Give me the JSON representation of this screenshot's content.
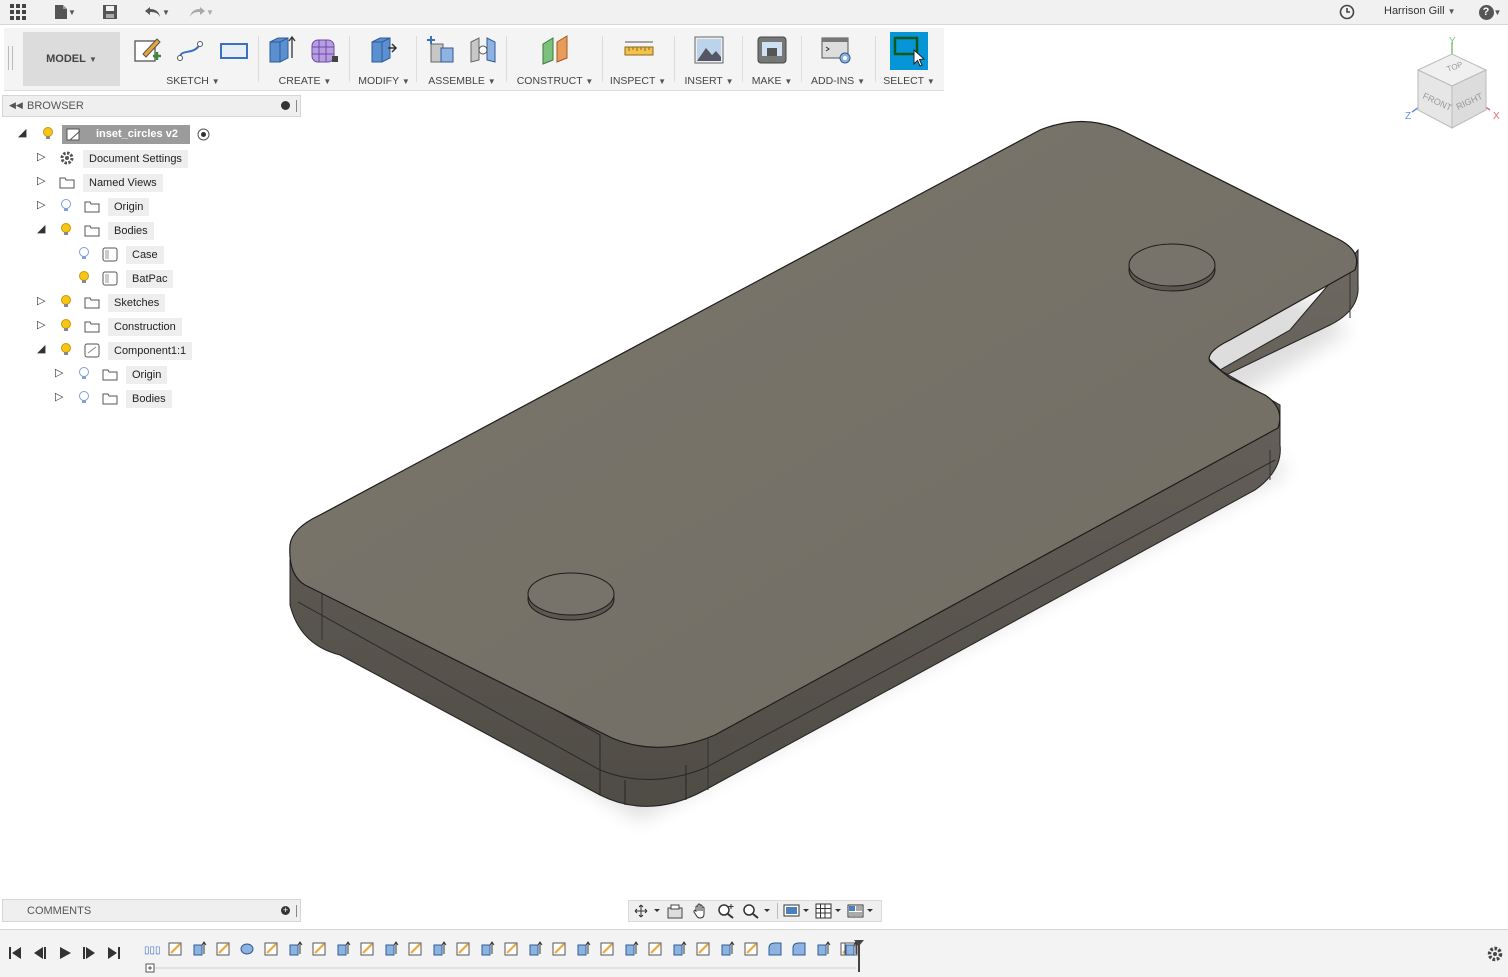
{
  "top_bar": {
    "user_name": "Harrison Gill",
    "icons": [
      "app-grid-icon",
      "file-icon",
      "save-icon",
      "undo-icon",
      "redo-icon",
      "job-status-icon",
      "help-icon"
    ],
    "help_label": "?"
  },
  "toolbar": {
    "workspace": "MODEL",
    "groups": [
      {
        "label": "SKETCH",
        "tools": [
          "create-sketch-icon",
          "line-icon",
          "rectangle-icon"
        ]
      },
      {
        "label": "CREATE",
        "tools": [
          "extrude-icon",
          "form-icon"
        ]
      },
      {
        "label": "MODIFY",
        "tools": [
          "press-pull-icon"
        ]
      },
      {
        "label": "ASSEMBLE",
        "tools": [
          "new-component-icon",
          "joint-icon"
        ]
      },
      {
        "label": "CONSTRUCT",
        "tools": [
          "offset-plane-icon"
        ]
      },
      {
        "label": "INSPECT",
        "tools": [
          "measure-icon"
        ]
      },
      {
        "label": "INSERT",
        "tools": [
          "insert-image-icon"
        ]
      },
      {
        "label": "MAKE",
        "tools": [
          "print-3d-icon"
        ]
      },
      {
        "label": "ADD-INS",
        "tools": [
          "scripts-icon"
        ]
      },
      {
        "label": "SELECT",
        "tools": [
          "select-icon"
        ]
      }
    ]
  },
  "browser": {
    "title": "BROWSER",
    "root": "inset_circles v2",
    "items": [
      {
        "label": "Document Settings",
        "expanded": false,
        "icon": "gear-icon"
      },
      {
        "label": "Named Views",
        "expanded": false,
        "icon": "folder-icon"
      },
      {
        "label": "Origin",
        "expanded": false,
        "icon": "folder-icon"
      },
      {
        "label": "Bodies",
        "expanded": true,
        "icon": "folder-icon"
      },
      {
        "label": "Case",
        "icon": "body-icon"
      },
      {
        "label": "BatPac",
        "icon": "body-icon"
      },
      {
        "label": "Sketches",
        "expanded": false,
        "icon": "folder-icon"
      },
      {
        "label": "Construction",
        "expanded": false,
        "icon": "folder-icon"
      },
      {
        "label": "Component1:1",
        "expanded": true,
        "icon": "component-icon"
      },
      {
        "label": "Origin",
        "expanded": false,
        "icon": "folder-icon"
      },
      {
        "label": "Bodies",
        "expanded": false,
        "icon": "folder-icon"
      }
    ]
  },
  "viewcube": {
    "top": "TOP",
    "front": "FRONT",
    "right": "RIGHT",
    "axis_x": "X",
    "axis_y": "Y",
    "axis_z": "Z"
  },
  "comments": {
    "title": "COMMENTS"
  },
  "colors": {
    "select_accent": "#0696d7",
    "body_top": "#757067",
    "body_side": "#5e5a53",
    "bulb_on": "#f5c518",
    "bulb_off": "#7da2d6"
  }
}
